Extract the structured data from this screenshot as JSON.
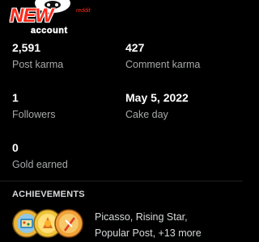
{
  "profile": {
    "logo": {
      "new_text": "NEW",
      "reddit_text": "reddit",
      "account_text": "account"
    }
  },
  "stats": {
    "post_karma": {
      "value": "2,591",
      "label": "Post karma"
    },
    "comment_karma": {
      "value": "427",
      "label": "Comment karma"
    },
    "followers": {
      "value": "1",
      "label": "Followers"
    },
    "cake_day": {
      "value": "May 5, 2022",
      "label": "Cake day"
    },
    "gold_earned": {
      "value": "0",
      "label": "Gold earned"
    }
  },
  "achievements": {
    "heading": "ACHIEVEMENTS",
    "line1": "Picasso, Rising Star,",
    "line2": "Popular Post, +13 more",
    "badges": [
      "picasso-badge-icon",
      "rising-star-badge-icon",
      "popular-post-badge-icon"
    ]
  },
  "colors": {
    "background": "#000000",
    "value_text": "#ffffff",
    "label_text": "#a8aaab",
    "logo_red": "#ff2a1a"
  }
}
